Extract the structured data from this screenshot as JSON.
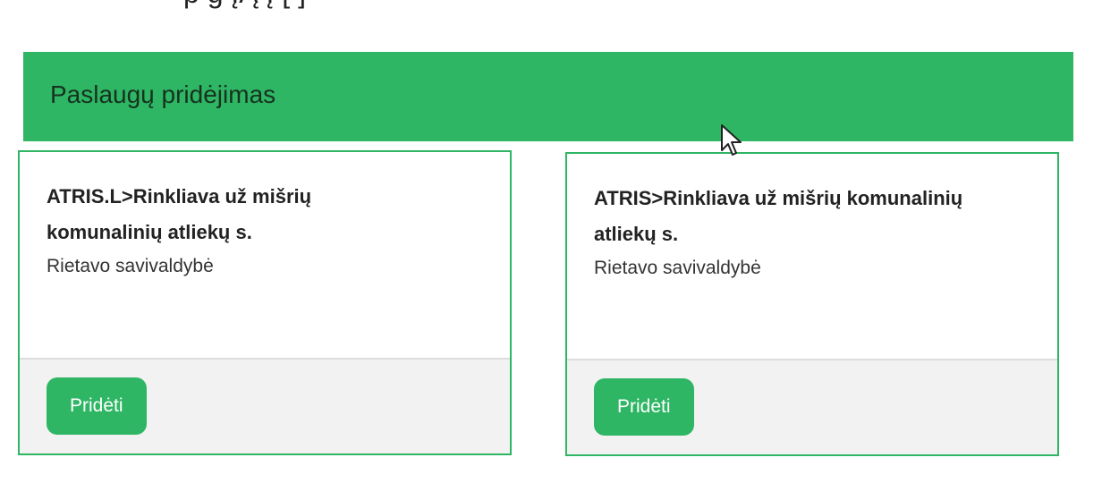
{
  "top_text_fragment": "p      g ĮĄ    Į       [       ]",
  "header": {
    "title": "Paslaugų pridėjimas"
  },
  "cards": [
    {
      "title": "ATRIS.L>Rinkliava už mišrių komunalinių atliekų s.",
      "subtitle": "Rietavo savivaldybė",
      "button_label": "Pridėti"
    },
    {
      "title": "ATRIS>Rinkliava už mišrių komunalinių atliekų s.",
      "subtitle": "Rietavo savivaldybė",
      "button_label": "Pridėti"
    }
  ],
  "colors": {
    "accent": "#2eb664",
    "footer_bg": "#f2f2f2"
  },
  "icons": {
    "cursor": "mouse-pointer-icon"
  }
}
